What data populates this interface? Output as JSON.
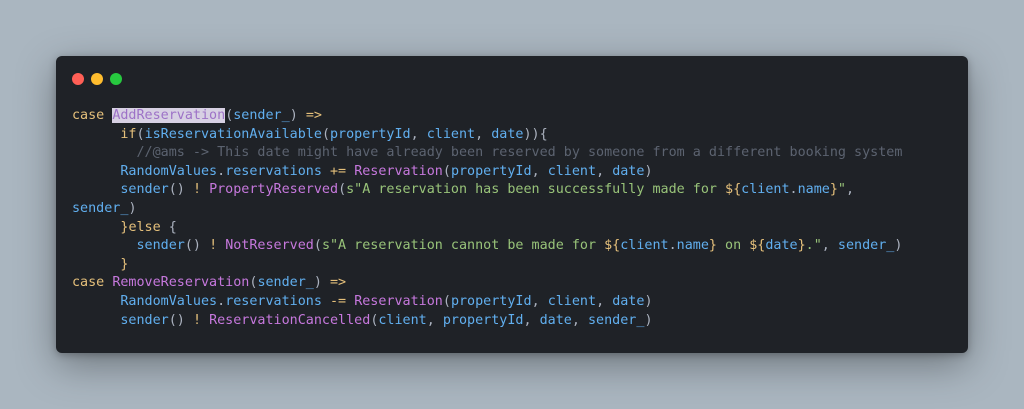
{
  "window": {
    "colors": {
      "close": "#ff5f56",
      "minimize": "#ffbd2e",
      "zoom": "#27c93f"
    }
  },
  "code": {
    "lines": [
      [
        {
          "t": "case ",
          "c": "kw"
        },
        {
          "t": "AddReservation",
          "c": "hl"
        },
        {
          "t": "(",
          "c": "plain"
        },
        {
          "t": "sender_",
          "c": "param"
        },
        {
          "t": ") ",
          "c": "plain"
        },
        {
          "t": "=>",
          "c": "op"
        }
      ],
      [
        {
          "t": "      ",
          "c": "plain"
        },
        {
          "t": "if",
          "c": "kw"
        },
        {
          "t": "(",
          "c": "plain"
        },
        {
          "t": "isReservationAvailable",
          "c": "param"
        },
        {
          "t": "(",
          "c": "plain"
        },
        {
          "t": "propertyId",
          "c": "param"
        },
        {
          "t": ", ",
          "c": "plain"
        },
        {
          "t": "client",
          "c": "param"
        },
        {
          "t": ", ",
          "c": "plain"
        },
        {
          "t": "date",
          "c": "param"
        },
        {
          "t": ")){",
          "c": "plain"
        }
      ],
      [
        {
          "t": "        ",
          "c": "plain"
        },
        {
          "t": "//@ams -> This date might have already been reserved by someone from a different booking system",
          "c": "cmt"
        }
      ],
      [
        {
          "t": "      ",
          "c": "plain"
        },
        {
          "t": "RandomValues",
          "c": "param"
        },
        {
          "t": ".",
          "c": "plain"
        },
        {
          "t": "reservations",
          "c": "param"
        },
        {
          "t": " ",
          "c": "plain"
        },
        {
          "t": "+=",
          "c": "op"
        },
        {
          "t": " ",
          "c": "plain"
        },
        {
          "t": "Reservation",
          "c": "fn"
        },
        {
          "t": "(",
          "c": "plain"
        },
        {
          "t": "propertyId",
          "c": "param"
        },
        {
          "t": ", ",
          "c": "plain"
        },
        {
          "t": "client",
          "c": "param"
        },
        {
          "t": ", ",
          "c": "plain"
        },
        {
          "t": "date",
          "c": "param"
        },
        {
          "t": ")",
          "c": "plain"
        }
      ],
      [
        {
          "t": "      ",
          "c": "plain"
        },
        {
          "t": "sender",
          "c": "param"
        },
        {
          "t": "() ",
          "c": "plain"
        },
        {
          "t": "!",
          "c": "op"
        },
        {
          "t": " ",
          "c": "plain"
        },
        {
          "t": "PropertyReserved",
          "c": "fn"
        },
        {
          "t": "(",
          "c": "plain"
        },
        {
          "t": "s\"A reservation has been successfully made for ",
          "c": "str"
        },
        {
          "t": "${",
          "c": "kw"
        },
        {
          "t": "client",
          "c": "param"
        },
        {
          "t": ".",
          "c": "plain"
        },
        {
          "t": "name",
          "c": "param"
        },
        {
          "t": "}",
          "c": "kw"
        },
        {
          "t": "\"",
          "c": "str"
        },
        {
          "t": ",",
          "c": "plain"
        }
      ],
      [
        {
          "t": "sender_",
          "c": "param"
        },
        {
          "t": ")",
          "c": "plain"
        }
      ],
      [
        {
          "t": "      ",
          "c": "plain"
        },
        {
          "t": "}",
          "c": "kw"
        },
        {
          "t": "else",
          "c": "kw"
        },
        {
          "t": " {",
          "c": "plain"
        }
      ],
      [
        {
          "t": "        ",
          "c": "plain"
        },
        {
          "t": "sender",
          "c": "param"
        },
        {
          "t": "() ",
          "c": "plain"
        },
        {
          "t": "!",
          "c": "op"
        },
        {
          "t": " ",
          "c": "plain"
        },
        {
          "t": "NotReserved",
          "c": "fn"
        },
        {
          "t": "(",
          "c": "plain"
        },
        {
          "t": "s\"A reservation cannot be made for ",
          "c": "str"
        },
        {
          "t": "${",
          "c": "kw"
        },
        {
          "t": "client",
          "c": "param"
        },
        {
          "t": ".",
          "c": "plain"
        },
        {
          "t": "name",
          "c": "param"
        },
        {
          "t": "}",
          "c": "kw"
        },
        {
          "t": " on ",
          "c": "str"
        },
        {
          "t": "${",
          "c": "kw"
        },
        {
          "t": "date",
          "c": "param"
        },
        {
          "t": "}",
          "c": "kw"
        },
        {
          "t": ".\"",
          "c": "str"
        },
        {
          "t": ", ",
          "c": "plain"
        },
        {
          "t": "sender_",
          "c": "param"
        },
        {
          "t": ")",
          "c": "plain"
        }
      ],
      [
        {
          "t": "      ",
          "c": "plain"
        },
        {
          "t": "}",
          "c": "kw"
        }
      ],
      [
        {
          "t": "case ",
          "c": "kw"
        },
        {
          "t": "RemoveReservation",
          "c": "fn"
        },
        {
          "t": "(",
          "c": "plain"
        },
        {
          "t": "sender_",
          "c": "param"
        },
        {
          "t": ") ",
          "c": "plain"
        },
        {
          "t": "=>",
          "c": "op"
        }
      ],
      [
        {
          "t": "      ",
          "c": "plain"
        },
        {
          "t": "RandomValues",
          "c": "param"
        },
        {
          "t": ".",
          "c": "plain"
        },
        {
          "t": "reservations",
          "c": "param"
        },
        {
          "t": " ",
          "c": "plain"
        },
        {
          "t": "-=",
          "c": "op"
        },
        {
          "t": " ",
          "c": "plain"
        },
        {
          "t": "Reservation",
          "c": "fn"
        },
        {
          "t": "(",
          "c": "plain"
        },
        {
          "t": "propertyId",
          "c": "param"
        },
        {
          "t": ", ",
          "c": "plain"
        },
        {
          "t": "client",
          "c": "param"
        },
        {
          "t": ", ",
          "c": "plain"
        },
        {
          "t": "date",
          "c": "param"
        },
        {
          "t": ")",
          "c": "plain"
        }
      ],
      [
        {
          "t": "      ",
          "c": "plain"
        },
        {
          "t": "sender",
          "c": "param"
        },
        {
          "t": "() ",
          "c": "plain"
        },
        {
          "t": "!",
          "c": "op"
        },
        {
          "t": " ",
          "c": "plain"
        },
        {
          "t": "ReservationCancelled",
          "c": "fn"
        },
        {
          "t": "(",
          "c": "plain"
        },
        {
          "t": "client",
          "c": "param"
        },
        {
          "t": ", ",
          "c": "plain"
        },
        {
          "t": "propertyId",
          "c": "param"
        },
        {
          "t": ", ",
          "c": "plain"
        },
        {
          "t": "date",
          "c": "param"
        },
        {
          "t": ", ",
          "c": "plain"
        },
        {
          "t": "sender_",
          "c": "param"
        },
        {
          "t": ")",
          "c": "plain"
        }
      ]
    ]
  }
}
